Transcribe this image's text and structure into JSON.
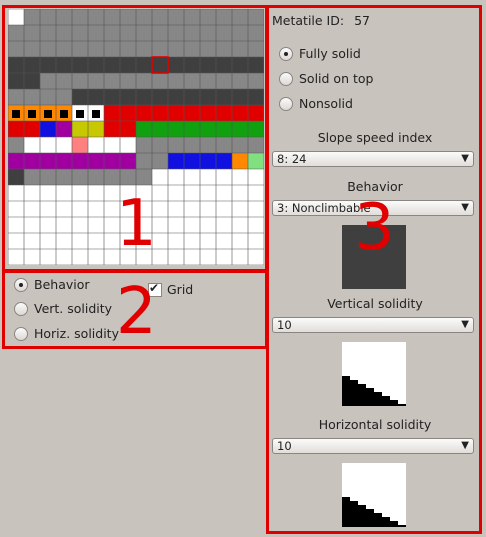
{
  "colors": {
    "accent_red": "#e00000",
    "panel_bg": "#c9c3be"
  },
  "annotations": {
    "n1": "1",
    "n2": "2",
    "n3": "3"
  },
  "metatile": {
    "label": "Metatile ID:",
    "id": "57"
  },
  "solidity_options": [
    {
      "label": "Fully solid",
      "selected": true
    },
    {
      "label": "Solid on top",
      "selected": false
    },
    {
      "label": "Nonsolid",
      "selected": false
    }
  ],
  "slope": {
    "label": "Slope speed index",
    "value": "8: 24"
  },
  "behavior": {
    "label": "Behavior",
    "value": "3: Nonclimbable"
  },
  "vertical": {
    "label": "Vertical solidity",
    "value": "10"
  },
  "horizontal": {
    "label": "Horizontal solidity",
    "value": "10"
  },
  "view_options": [
    {
      "label": "Behavior",
      "selected": true
    },
    {
      "label": "Vert. solidity",
      "selected": false
    },
    {
      "label": "Horiz. solidity",
      "selected": false
    }
  ],
  "grid_toggle": {
    "label": "Grid",
    "checked": true
  }
}
